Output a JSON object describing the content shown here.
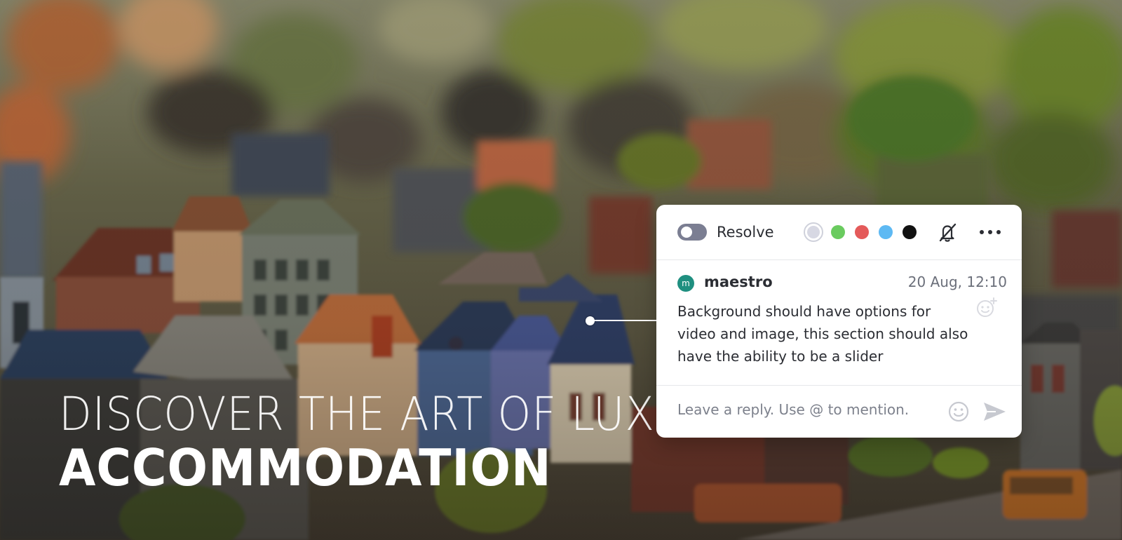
{
  "hero": {
    "line1": "DISCOVER THE ART OF LUXURY",
    "line2": "ACCOMMODATION"
  },
  "comment": {
    "toolbar": {
      "resolve_label": "Resolve",
      "resolved": false,
      "colors": [
        {
          "name": "gray",
          "hex": "#d7d8e3",
          "selected": true
        },
        {
          "name": "green",
          "hex": "#6acb5f",
          "selected": false
        },
        {
          "name": "red",
          "hex": "#e45a5a",
          "selected": false
        },
        {
          "name": "blue",
          "hex": "#5db9f3",
          "selected": false
        },
        {
          "name": "black",
          "hex": "#111111",
          "selected": false
        }
      ],
      "mute_icon": "bell-off-icon",
      "more_icon": "more-horizontal-icon"
    },
    "avatar_initial": "m",
    "author": "maestro",
    "timestamp": "20 Aug, 12:10",
    "text": "Background should have options for video and image, this section should also have the ability to be a slider",
    "reply": {
      "placeholder": "Leave a reply. Use @ to mention.",
      "value": ""
    }
  }
}
